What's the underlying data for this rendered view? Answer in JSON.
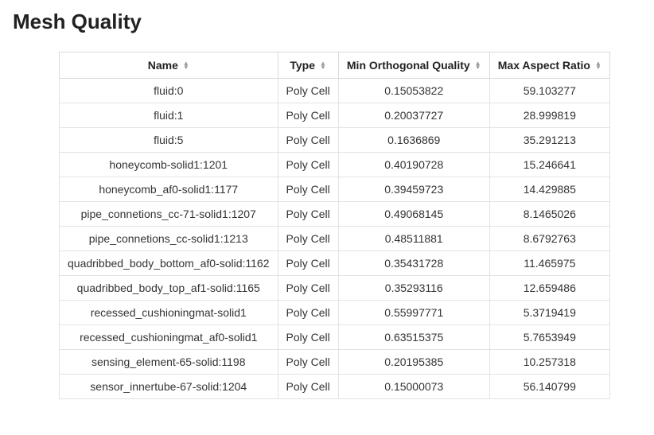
{
  "title": "Mesh Quality",
  "columns": {
    "name": "Name",
    "type": "Type",
    "min_orthogonal_quality": "Min Orthogonal Quality",
    "max_aspect_ratio": "Max Aspect Ratio"
  },
  "rows": [
    {
      "name": "fluid:0",
      "type": "Poly Cell",
      "min_orthogonal_quality": "0.15053822",
      "max_aspect_ratio": "59.103277"
    },
    {
      "name": "fluid:1",
      "type": "Poly Cell",
      "min_orthogonal_quality": "0.20037727",
      "max_aspect_ratio": "28.999819"
    },
    {
      "name": "fluid:5",
      "type": "Poly Cell",
      "min_orthogonal_quality": "0.1636869",
      "max_aspect_ratio": "35.291213"
    },
    {
      "name": "honeycomb-solid1:1201",
      "type": "Poly Cell",
      "min_orthogonal_quality": "0.40190728",
      "max_aspect_ratio": "15.246641"
    },
    {
      "name": "honeycomb_af0-solid1:1177",
      "type": "Poly Cell",
      "min_orthogonal_quality": "0.39459723",
      "max_aspect_ratio": "14.429885"
    },
    {
      "name": "pipe_connetions_cc-71-solid1:1207",
      "type": "Poly Cell",
      "min_orthogonal_quality": "0.49068145",
      "max_aspect_ratio": "8.1465026"
    },
    {
      "name": "pipe_connetions_cc-solid1:1213",
      "type": "Poly Cell",
      "min_orthogonal_quality": "0.48511881",
      "max_aspect_ratio": "8.6792763"
    },
    {
      "name": "quadribbed_body_bottom_af0-solid:1162",
      "type": "Poly Cell",
      "min_orthogonal_quality": "0.35431728",
      "max_aspect_ratio": "11.465975"
    },
    {
      "name": "quadribbed_body_top_af1-solid:1165",
      "type": "Poly Cell",
      "min_orthogonal_quality": "0.35293116",
      "max_aspect_ratio": "12.659486"
    },
    {
      "name": "recessed_cushioningmat-solid1",
      "type": "Poly Cell",
      "min_orthogonal_quality": "0.55997771",
      "max_aspect_ratio": "5.3719419"
    },
    {
      "name": "recessed_cushioningmat_af0-solid1",
      "type": "Poly Cell",
      "min_orthogonal_quality": "0.63515375",
      "max_aspect_ratio": "5.7653949"
    },
    {
      "name": "sensing_element-65-solid:1198",
      "type": "Poly Cell",
      "min_orthogonal_quality": "0.20195385",
      "max_aspect_ratio": "10.257318"
    },
    {
      "name": "sensor_innertube-67-solid:1204",
      "type": "Poly Cell",
      "min_orthogonal_quality": "0.15000073",
      "max_aspect_ratio": "56.140799"
    }
  ]
}
